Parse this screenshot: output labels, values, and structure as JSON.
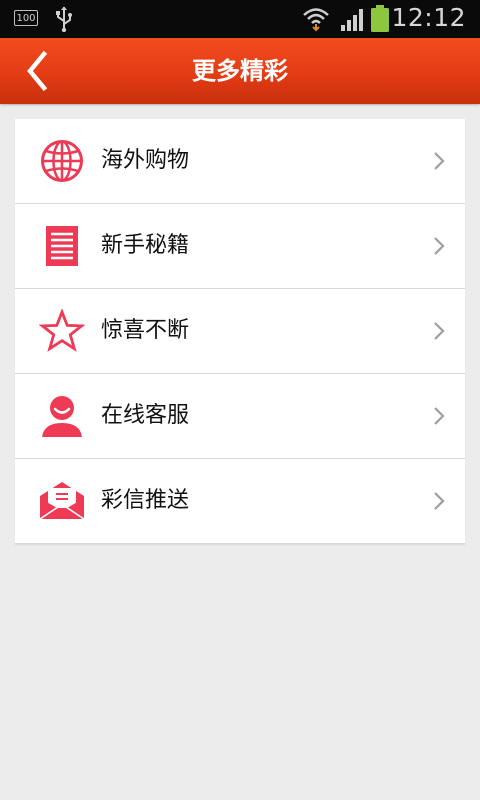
{
  "status_bar": {
    "battery_level": "100",
    "time": "12:12",
    "icons": [
      "battery-level-icon",
      "usb-icon",
      "wifi-icon",
      "signal-icon",
      "battery-icon"
    ]
  },
  "header": {
    "title": "更多精彩",
    "back_icon": "chevron-left-icon"
  },
  "menu": {
    "items": [
      {
        "label": "海外购物",
        "icon": "globe-icon"
      },
      {
        "label": "新手秘籍",
        "icon": "document-icon"
      },
      {
        "label": "惊喜不断",
        "icon": "star-icon"
      },
      {
        "label": "在线客服",
        "icon": "person-icon"
      },
      {
        "label": "彩信推送",
        "icon": "envelope-icon"
      }
    ]
  },
  "colors": {
    "header_bg": "#e43c14",
    "accent": "#ee3a55",
    "page_bg": "#ececec",
    "chevron": "#9e9e9e"
  }
}
